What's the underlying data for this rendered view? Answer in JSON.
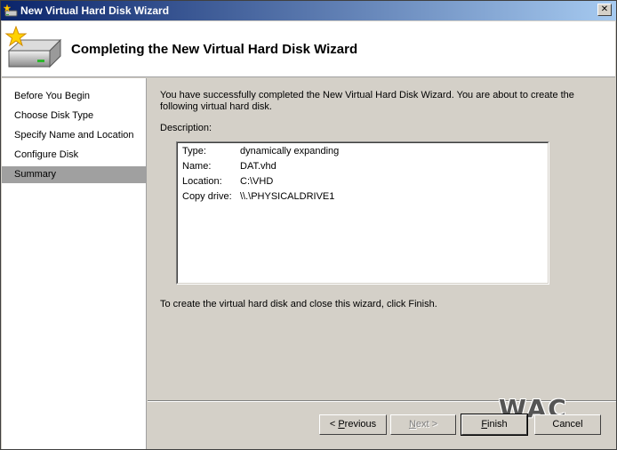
{
  "window": {
    "title": "New Virtual Hard Disk Wizard",
    "close_glyph": "✕"
  },
  "header": {
    "title": "Completing the New Virtual Hard Disk Wizard"
  },
  "sidebar": {
    "items": [
      {
        "label": "Before You Begin",
        "active": false
      },
      {
        "label": "Choose Disk Type",
        "active": false
      },
      {
        "label": "Specify Name and Location",
        "active": false
      },
      {
        "label": "Configure Disk",
        "active": false
      },
      {
        "label": "Summary",
        "active": true
      }
    ]
  },
  "main": {
    "intro": "You have successfully completed the New Virtual Hard Disk Wizard. You are about to create the following virtual hard disk.",
    "description_label": "Description:",
    "description": [
      {
        "key": "Type:",
        "value": "dynamically expanding"
      },
      {
        "key": "Name:",
        "value": "DAT.vhd"
      },
      {
        "key": "Location:",
        "value": "C:\\VHD"
      },
      {
        "key": "Copy drive:",
        "value": "\\\\.\\PHYSICALDRIVE1"
      }
    ],
    "finish_text": "To create the virtual hard disk and close this wizard, click Finish."
  },
  "buttons": {
    "previous": {
      "prefix": "< ",
      "mnemonic": "P",
      "rest": "revious"
    },
    "next": {
      "mnemonic": "N",
      "rest": "ext >"
    },
    "finish": {
      "mnemonic": "F",
      "rest": "inish"
    },
    "cancel": {
      "label": "Cancel"
    }
  },
  "watermark": "WAC",
  "icons": {
    "title": "disk-star-icon",
    "header": "hard-disk-star-icon",
    "close": "close-icon"
  }
}
